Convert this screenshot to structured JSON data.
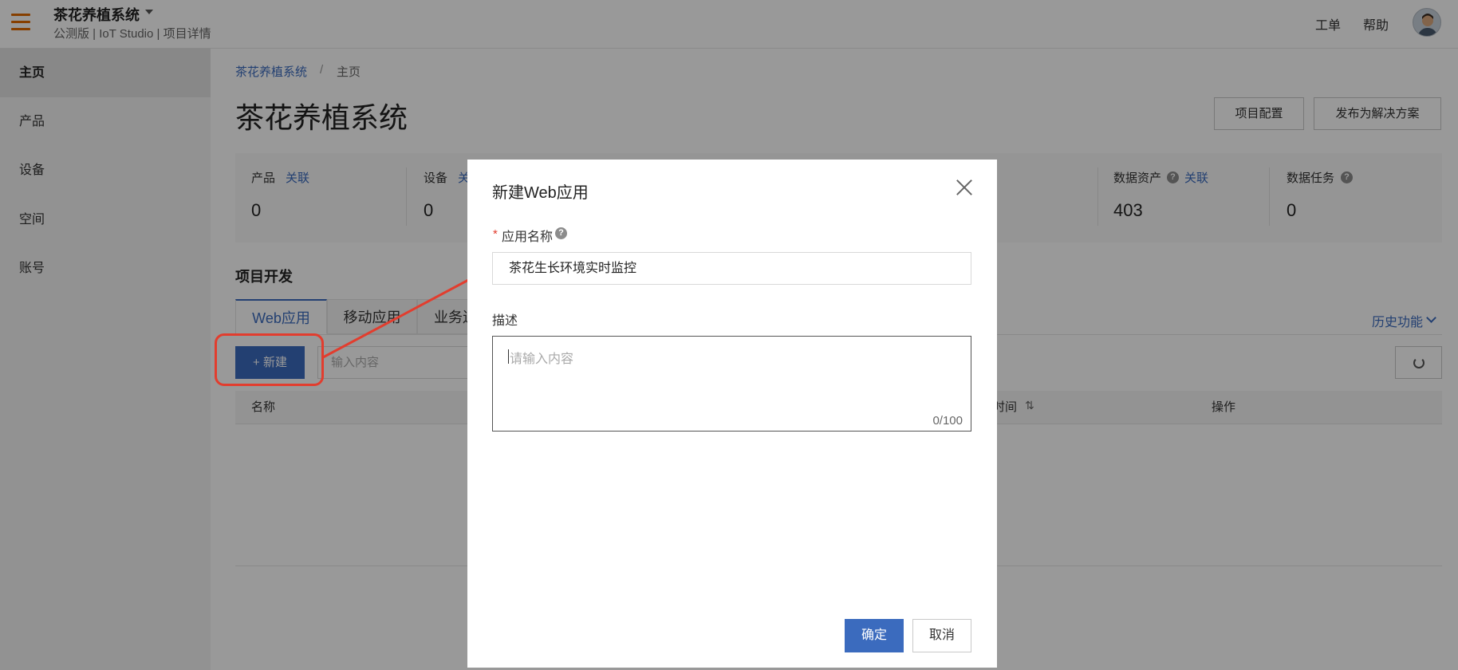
{
  "topbar": {
    "app_title": "茶花养植系统",
    "subtitle": "公测版 | IoT Studio | 项目详情",
    "work_order": "工单",
    "help": "帮助",
    "menu_icon": "hamburger-menu-icon",
    "caret_icon": "caret-down-icon",
    "avatar": "user-avatar",
    "accent_color": "#e06a00"
  },
  "sidebar": {
    "items": [
      {
        "label": "主页",
        "active": true
      },
      {
        "label": "产品"
      },
      {
        "label": "设备"
      },
      {
        "label": "空间"
      },
      {
        "label": "账号"
      }
    ]
  },
  "breadcrumb": {
    "link": "茶花养植系统",
    "separator": "/",
    "current": "主页"
  },
  "page": {
    "title": "茶花养植系统",
    "config_button": "项目配置",
    "publish_button": "发布为解决方案"
  },
  "stats": [
    {
      "label": "产品",
      "link": "关联",
      "value": "0"
    },
    {
      "label": "设备",
      "link": "关",
      "value": "0"
    },
    {
      "label": "数据资产",
      "link": "关联",
      "value": "403",
      "help": true
    },
    {
      "label": "数据任务",
      "value": "0",
      "help": true
    }
  ],
  "project_dev": {
    "title": "项目开发",
    "tabs": [
      {
        "label": "Web应用",
        "active": true
      },
      {
        "label": "移动应用"
      },
      {
        "label": "业务逻"
      }
    ],
    "history": "历史功能",
    "new_button": "+ 新建",
    "search_placeholder": "输入内容",
    "table_headers": {
      "name": "名称",
      "time": "时间",
      "actions": "操作"
    }
  },
  "modal": {
    "title": "新建Web应用",
    "name_label": "应用名称",
    "name_value": "茶花生长环境实时监控",
    "desc_label": "描述",
    "desc_placeholder": "请输入内容",
    "desc_count": "0/100",
    "ok": "确定",
    "cancel": "取消"
  },
  "colors": {
    "primary": "#3b6bbe",
    "annotation_red": "#e23d2e"
  }
}
